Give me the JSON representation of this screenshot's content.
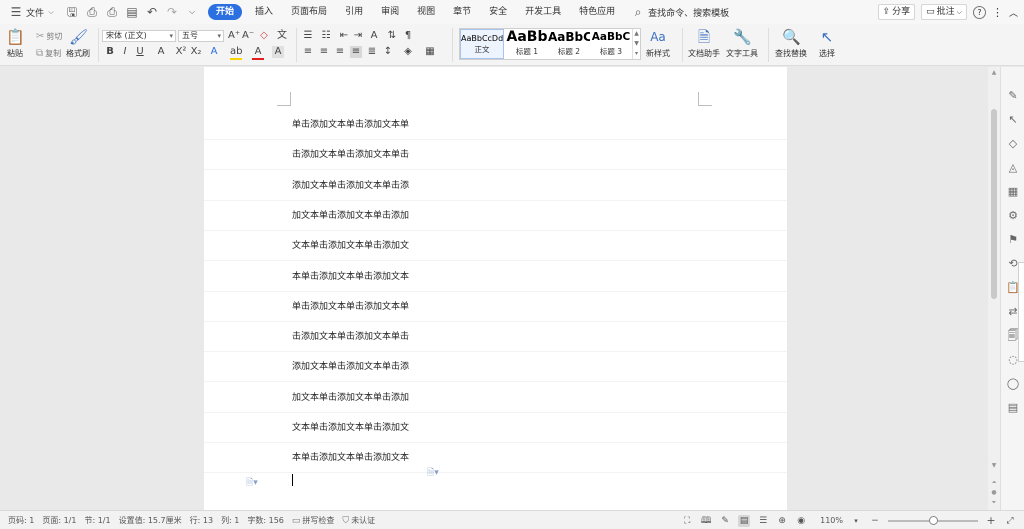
{
  "menubar": {
    "file_menu": "文件",
    "tabs": [
      "开始",
      "插入",
      "页面布局",
      "引用",
      "审阅",
      "视图",
      "章节",
      "安全",
      "开发工具",
      "特色应用"
    ],
    "active_tab": "开始",
    "search_placeholder": "查找命令、搜索模板",
    "share_label": "分享",
    "comment_label": "批注",
    "help_label": "?"
  },
  "ribbon": {
    "paste": "粘贴",
    "cut": "剪切",
    "copy": "复制",
    "format_painter": "格式刷",
    "font_name": "宋体 (正文)",
    "font_size": "五号",
    "styles": [
      {
        "preview": "AaBbCcDd",
        "name": "正文"
      },
      {
        "preview": "AaBb",
        "name": "标题 1"
      },
      {
        "preview": "AaBbC",
        "name": "标题 2"
      },
      {
        "preview": "AaBbC",
        "name": "标题 3"
      }
    ],
    "new_style": "新样式",
    "doc_assistant": "文档助手",
    "text_tools": "文字工具",
    "find_replace": "查找替换",
    "select": "选择"
  },
  "document": {
    "lines": [
      "单击添加文本单击添加文本单",
      "击添加文本单击添加文本单击",
      "添加文本单击添加文本单击添",
      "加文本单击添加文本单击添加",
      "文本单击添加文本单击添加文",
      "本单击添加文本单击添加文本",
      "单击添加文本单击添加文本单",
      "击添加文本单击添加文本单击",
      "添加文本单击添加文本单击添",
      "加文本单击添加文本单击添加",
      "文本单击添加文本单击添加文",
      "本单击添加文本单击添加文本"
    ]
  },
  "statusbar": {
    "page_num": "页码: 1",
    "pages": "页面: 1/1",
    "section": "节: 1/1",
    "setting": "设置值: 15.7厘米",
    "row": "行: 13",
    "col": "列: 1",
    "word_count": "字数: 156",
    "spell_check": "拼写检查",
    "cert": "未认证",
    "zoom": "110%",
    "zoom_fraction": 0.5
  }
}
